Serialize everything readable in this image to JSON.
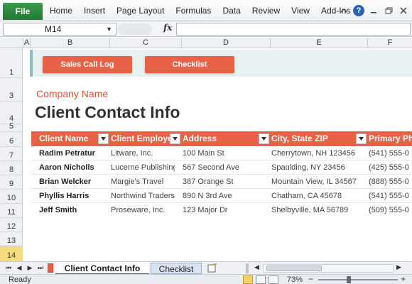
{
  "ribbon": {
    "file_label": "File",
    "tabs": [
      "Home",
      "Insert",
      "Page Layout",
      "Formulas",
      "Data",
      "Review",
      "View",
      "Add-Ins"
    ],
    "help_label": "?"
  },
  "formula_bar": {
    "name_box": "M14",
    "fx_label": "fx",
    "formula": ""
  },
  "columns": [
    "A",
    "B",
    "C",
    "D",
    "E",
    "F"
  ],
  "rows": [
    "1",
    "3",
    "4",
    "5",
    "6",
    "7",
    "8",
    "9",
    "10",
    "11",
    "12",
    "13",
    "14"
  ],
  "selected_row": "14",
  "buttons": {
    "sales_call_log": "Sales Call Log",
    "checklist": "Checklist"
  },
  "company_name": "Company Name",
  "title": "Client Contact Info",
  "table": {
    "headers": [
      "Client Name",
      "Client Employe",
      "Address",
      "City, State ZIP",
      "Primary Ph"
    ],
    "rows": [
      [
        "Radim Petratur",
        "Litware, Inc.",
        "100 Main St",
        "Cherrytown, NH 123456",
        "(541) 555-0"
      ],
      [
        "Aaron Nicholls",
        "Lucerne Publishing",
        "567 Second Ave",
        "Spaulding, NY 23456",
        "(425) 555-0"
      ],
      [
        "Brian Welcker",
        "Margie's Travel",
        "387 Orange St",
        "Mountain View, IL 34567",
        "(888) 555-0"
      ],
      [
        "Phyllis Harris",
        "Northwind Traders",
        "890 N 3rd Ave",
        "Chatham, CA 45678",
        "(541) 555-0"
      ],
      [
        "Jeff Smith",
        "Proseware, Inc.",
        "123 Major Dr",
        "Shelbyville, MA 56789",
        "(509) 555-0"
      ]
    ]
  },
  "sheet_tabs": {
    "active": "Client Contact Info",
    "other": "Checklist"
  },
  "status": {
    "ready": "Ready",
    "zoom": "73%",
    "zoom_percent": 73
  },
  "colors": {
    "file_tab": "#2b8a3e",
    "accent": "#e96147",
    "company_text": "#d8553a",
    "header_band": "#e7f1f2",
    "selected_row": "#f7dc7a"
  }
}
